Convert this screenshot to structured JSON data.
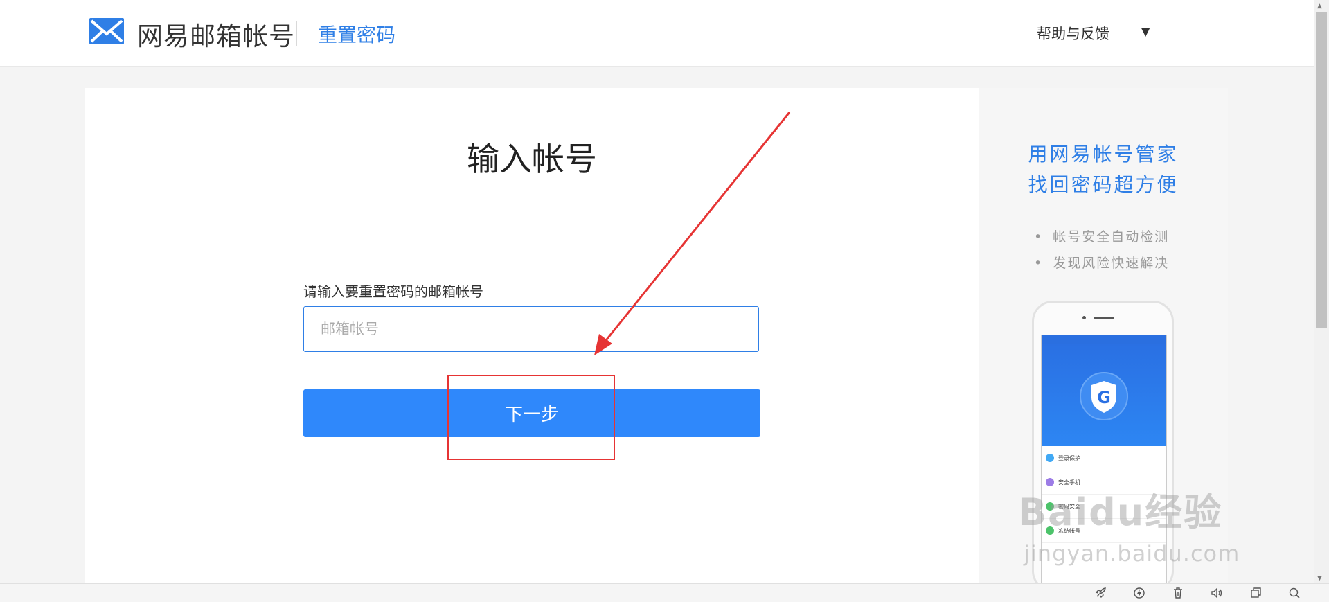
{
  "header": {
    "brand": "网易邮箱帐号",
    "subtitle": "重置密码",
    "help_label": "帮助与反馈",
    "help_caret": "▼"
  },
  "form": {
    "title": "输入帐号",
    "field_label": "请输入要重置密码的邮箱帐号",
    "account_placeholder": "邮箱帐号",
    "account_value": "",
    "next_label": "下一步"
  },
  "promo": {
    "title_line1": "用网易帐号管家",
    "title_line2": "找回密码超方便",
    "bullets": [
      "帐号安全自动检测",
      "发现风险快速解决"
    ],
    "phone_items": [
      "登录保护",
      "安全手机",
      "密码安全",
      "冻结帐号"
    ]
  },
  "watermark": {
    "logo_text": "Baidu经验",
    "url": "jingyan.baidu.com"
  },
  "colors": {
    "accent": "#2f7fe6",
    "button": "#2f88fb",
    "annotation": "#e63434"
  }
}
